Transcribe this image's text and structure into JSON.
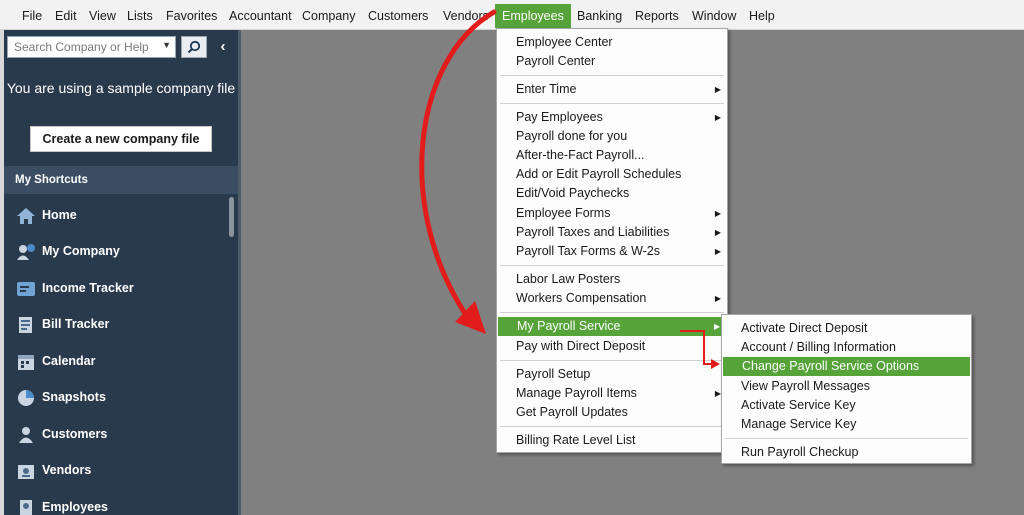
{
  "menubar": {
    "items": [
      "File",
      "Edit",
      "View",
      "Lists",
      "Favorites",
      "Accountant",
      "Company",
      "Customers",
      "Vendors",
      "Employees",
      "Banking",
      "Reports",
      "Window",
      "Help"
    ]
  },
  "sidebar": {
    "search_placeholder": "Search Company or Help",
    "sample_text": "You are using a sample company file",
    "create_button": "Create a new company file",
    "shortcuts_header": "My Shortcuts",
    "shortcuts": [
      {
        "label": "Home",
        "icon": "home-icon"
      },
      {
        "label": "My Company",
        "icon": "my-company-icon"
      },
      {
        "label": "Income Tracker",
        "icon": "income-tracker-icon"
      },
      {
        "label": "Bill Tracker",
        "icon": "bill-tracker-icon"
      },
      {
        "label": "Calendar",
        "icon": "calendar-icon"
      },
      {
        "label": "Snapshots",
        "icon": "pie-chart-icon"
      },
      {
        "label": "Customers",
        "icon": "person-icon"
      },
      {
        "label": "Vendors",
        "icon": "vendor-icon"
      },
      {
        "label": "Employees",
        "icon": "employee-icon"
      }
    ]
  },
  "employees_menu": {
    "items": [
      {
        "label": "Employee Center",
        "submenu": false
      },
      {
        "label": "Payroll Center",
        "submenu": false
      },
      {
        "label": "Enter Time",
        "submenu": true
      },
      {
        "label": "Pay Employees",
        "submenu": true
      },
      {
        "label": "Payroll done for you",
        "submenu": false
      },
      {
        "label": "After-the-Fact Payroll...",
        "submenu": false
      },
      {
        "label": "Add or Edit Payroll Schedules",
        "submenu": false
      },
      {
        "label": "Edit/Void Paychecks",
        "submenu": false
      },
      {
        "label": "Employee Forms",
        "submenu": true
      },
      {
        "label": "Payroll Taxes and Liabilities",
        "submenu": true
      },
      {
        "label": "Payroll Tax Forms & W-2s",
        "submenu": true
      },
      {
        "label": "Labor Law Posters",
        "submenu": false
      },
      {
        "label": "Workers Compensation",
        "submenu": true
      },
      {
        "label": "My Payroll Service",
        "submenu": true,
        "highlighted": true
      },
      {
        "label": "Pay with Direct Deposit",
        "submenu": false
      },
      {
        "label": "Payroll Setup",
        "submenu": false
      },
      {
        "label": "Manage Payroll Items",
        "submenu": true
      },
      {
        "label": "Get Payroll Updates",
        "submenu": false
      },
      {
        "label": "Billing Rate Level List",
        "submenu": false
      }
    ]
  },
  "payroll_service_submenu": {
    "items": [
      {
        "label": "Activate Direct Deposit"
      },
      {
        "label": "Account / Billing Information"
      },
      {
        "label": "Change Payroll Service Options",
        "highlighted": true
      },
      {
        "label": "View Payroll Messages"
      },
      {
        "label": "Activate Service Key"
      },
      {
        "label": "Manage Service Key"
      },
      {
        "label": "Run Payroll Checkup"
      }
    ]
  },
  "colors": {
    "highlight": "#56a33a",
    "sidebar": "#2a3a4d",
    "workspace": "#808080",
    "annotation_arrow": "#e21b1b"
  }
}
